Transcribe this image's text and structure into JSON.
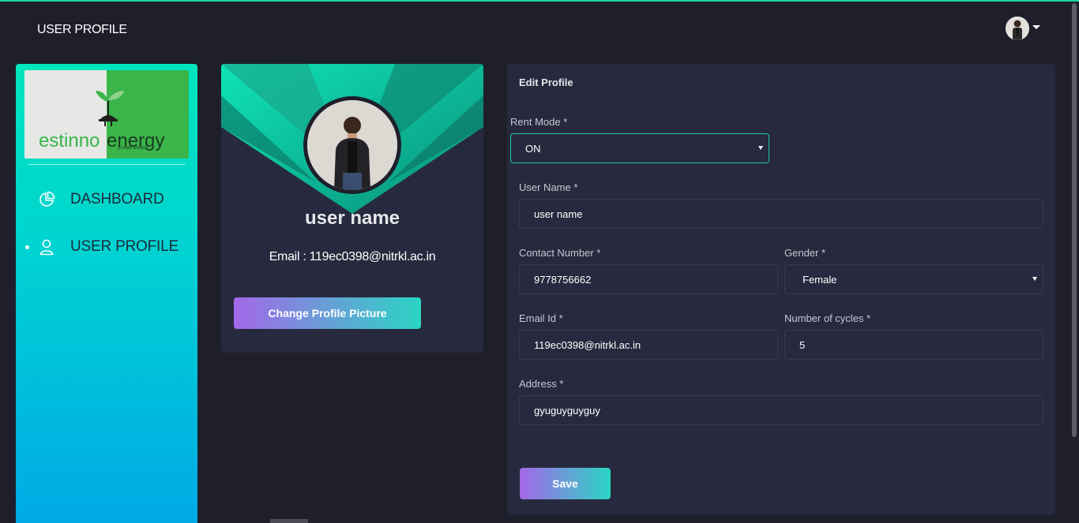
{
  "navbar": {
    "title": "USER PROFILE",
    "avatar_icon": "user-avatar",
    "caret_icon": "caret-down-icon"
  },
  "sidebar": {
    "logo": {
      "word1": "estinno",
      "word2": "energy",
      "subtext": "private limited"
    },
    "items": [
      {
        "label": "DASHBOARD",
        "icon": "pie-chart-icon",
        "active": false
      },
      {
        "label": "USER PROFILE",
        "icon": "user-icon",
        "active": true
      }
    ]
  },
  "profile": {
    "name": "user name",
    "email": "Email : 119ec0398@nitrkl.ac.in",
    "change_button": "Change Profile Picture"
  },
  "form": {
    "title": "Edit Profile",
    "rent_mode": {
      "label": "Rent Mode *",
      "value": "ON"
    },
    "user_name": {
      "label": "User Name *",
      "value": "user name"
    },
    "contact": {
      "label": "Contact Number *",
      "value": "9778756662"
    },
    "gender": {
      "label": "Gender *",
      "value": "Female"
    },
    "email": {
      "label": "Email Id *",
      "value": "119ec0398@nitrkl.ac.in"
    },
    "cycles": {
      "label": "Number of cycles *",
      "value": "5"
    },
    "address": {
      "label": "Address *",
      "value": "gyuguyguyguy"
    },
    "save_button": "Save"
  },
  "colors": {
    "background": "#1e1f2b",
    "card": "#272a3e",
    "accent": "#21c9a8",
    "sidebar_top": "#00e6bd",
    "sidebar_bottom": "#00a9e6"
  }
}
